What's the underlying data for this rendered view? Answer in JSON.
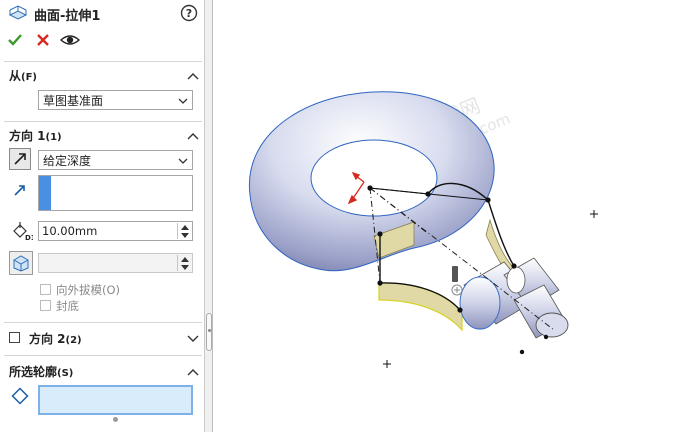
{
  "panel": {
    "title": "曲面-拉伸1",
    "from": {
      "title": "从",
      "hotkey": "(F)",
      "dropdown_value": "草图基准面"
    },
    "direction1": {
      "title": "方向 1",
      "hotkey": "(1)",
      "end_condition": "给定深度",
      "depth_value": "10.00mm",
      "depth_label": "D1",
      "draft_value": "",
      "draft_outward_label": "向外拔模(O)",
      "cap_end_label": "封底"
    },
    "direction2": {
      "title": "方向 2",
      "hotkey": "(2)"
    },
    "selected_contours": {
      "title": "所选轮廓",
      "hotkey": "(S)"
    }
  },
  "viewport": {
    "watermark_line1": "机械时代网",
    "watermark_line2": "www.jxage.com"
  },
  "colors": {
    "ok_green": "#3a9a2a",
    "cancel_red": "#d42a1f",
    "accent_blue": "#4a90e2",
    "selection_fill": "#d9ecfb",
    "surface_yellow": "#e0d9a6"
  }
}
